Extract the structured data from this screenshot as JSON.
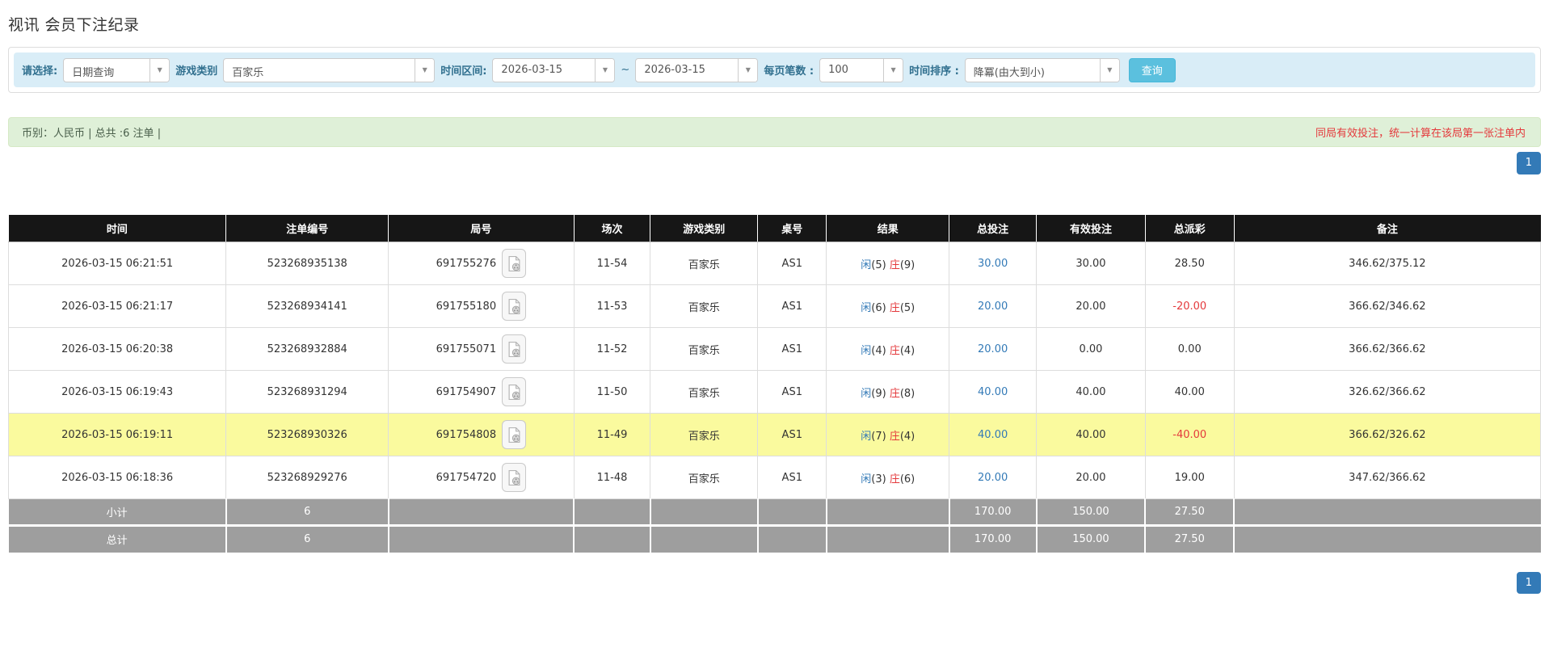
{
  "page": {
    "title": "视讯 会员下注纪录"
  },
  "filters": {
    "select_label": "请选择:",
    "select_value": "日期查询",
    "game_type_label": "游戏类别",
    "game_type_value": "百家乐",
    "time_range_label": "时间区间:",
    "date_from": "2026-03-15",
    "tilde": "~",
    "date_to": "2026-03-15",
    "page_size_label": "每页笔数 :",
    "page_size_value": "100",
    "sort_label": "时间排序 :",
    "sort_value": "降冪(由大到小)",
    "search_button": "查询",
    "dropdown_arrow": "▼"
  },
  "summary": {
    "left_text": "币别：人民币 | 总共 :6 注单 |",
    "right_note": "同局有效投注，统一计算在该局第一张注单内"
  },
  "pagination": {
    "page": "1"
  },
  "table": {
    "headers": [
      "时间",
      "注单编号",
      "局号",
      "场次",
      "游戏类别",
      "桌号",
      "结果",
      "总投注",
      "有效投注",
      "总派彩",
      "备注"
    ],
    "rows": [
      {
        "time": "2026-03-15 06:21:51",
        "bet_id": "523268935138",
        "round_id": "691755276",
        "session": "11-54",
        "game": "百家乐",
        "table_no": "AS1",
        "p_label": "闲",
        "p_val": "(5)",
        "b_label": "庄",
        "b_val": "(9)",
        "total_bet": "30.00",
        "valid_bet": "30.00",
        "payout": "28.50",
        "payout_negative": false,
        "remark": "346.62/375.12",
        "highlight": false
      },
      {
        "time": "2026-03-15 06:21:17",
        "bet_id": "523268934141",
        "round_id": "691755180",
        "session": "11-53",
        "game": "百家乐",
        "table_no": "AS1",
        "p_label": "闲",
        "p_val": "(6)",
        "b_label": "庄",
        "b_val": "(5)",
        "total_bet": "20.00",
        "valid_bet": "20.00",
        "payout": "-20.00",
        "payout_negative": true,
        "remark": "366.62/346.62",
        "highlight": false
      },
      {
        "time": "2026-03-15 06:20:38",
        "bet_id": "523268932884",
        "round_id": "691755071",
        "session": "11-52",
        "game": "百家乐",
        "table_no": "AS1",
        "p_label": "闲",
        "p_val": "(4)",
        "b_label": "庄",
        "b_val": "(4)",
        "total_bet": "20.00",
        "valid_bet": "0.00",
        "payout": "0.00",
        "payout_negative": false,
        "remark": "366.62/366.62",
        "highlight": false
      },
      {
        "time": "2026-03-15 06:19:43",
        "bet_id": "523268931294",
        "round_id": "691754907",
        "session": "11-50",
        "game": "百家乐",
        "table_no": "AS1",
        "p_label": "闲",
        "p_val": "(9)",
        "b_label": "庄",
        "b_val": "(8)",
        "total_bet": "40.00",
        "valid_bet": "40.00",
        "payout": "40.00",
        "payout_negative": false,
        "remark": "326.62/366.62",
        "highlight": false
      },
      {
        "time": "2026-03-15 06:19:11",
        "bet_id": "523268930326",
        "round_id": "691754808",
        "session": "11-49",
        "game": "百家乐",
        "table_no": "AS1",
        "p_label": "闲",
        "p_val": "(7)",
        "b_label": "庄",
        "b_val": "(4)",
        "total_bet": "40.00",
        "valid_bet": "40.00",
        "payout": "-40.00",
        "payout_negative": true,
        "remark": "366.62/326.62",
        "highlight": true
      },
      {
        "time": "2026-03-15 06:18:36",
        "bet_id": "523268929276",
        "round_id": "691754720",
        "session": "11-48",
        "game": "百家乐",
        "table_no": "AS1",
        "p_label": "闲",
        "p_val": "(3)",
        "b_label": "庄",
        "b_val": "(6)",
        "total_bet": "20.00",
        "valid_bet": "20.00",
        "payout": "19.00",
        "payout_negative": false,
        "remark": "347.62/366.62",
        "highlight": false
      }
    ],
    "subtotal": {
      "label": "小计",
      "count": "6",
      "total_bet": "170.00",
      "valid_bet": "150.00",
      "payout": "27.50"
    },
    "total": {
      "label": "总计",
      "count": "6",
      "total_bet": "170.00",
      "valid_bet": "150.00",
      "payout": "27.50"
    }
  },
  "colors": {
    "accent_blue": "#337ab7",
    "filter_bar_bg": "#d9edf7",
    "search_button_bg": "#5bc0de",
    "summary_bar_bg": "#dff0d8",
    "highlight_row_bg": "#fafa9e",
    "table_header_bg": "#161616",
    "summary_row_bg": "#9e9e9e",
    "negative_red": "#e4393c"
  }
}
